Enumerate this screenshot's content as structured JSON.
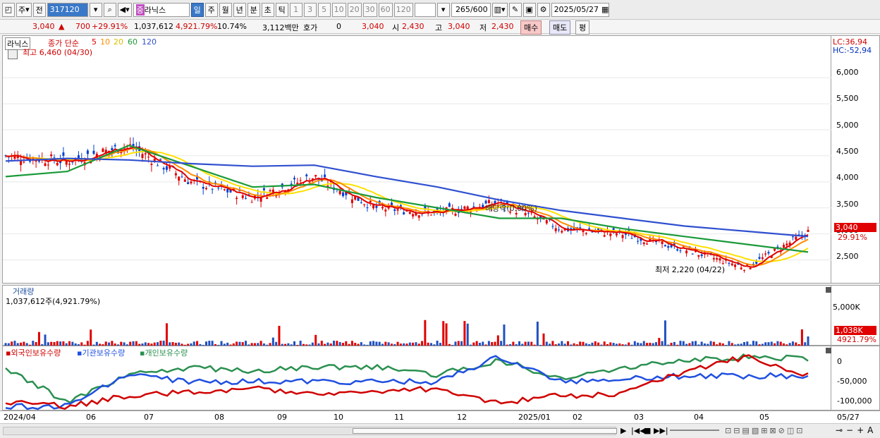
{
  "toolbar": {
    "code": "317120",
    "name": "라닉스",
    "mode1": "주",
    "mode2": "전",
    "periods": [
      "일",
      "주",
      "월",
      "년",
      "분",
      "초",
      "틱"
    ],
    "minutes": [
      "1",
      "3",
      "5",
      "10",
      "20",
      "30",
      "60",
      "120"
    ],
    "count": "265",
    "count_total": "/600",
    "date": "2025/05/27",
    "stock_tag": "중"
  },
  "info": {
    "price": "3,040",
    "change": "700",
    "change_pct": "+29.91%",
    "volume": "1,037,612",
    "vol_pct": "4,921.79%",
    "turnover": "10.74%",
    "amount": "3,112백만",
    "quote_label": "호가",
    "quote_val": "0",
    "quote_price": "3,040",
    "open_label": "시",
    "open": "2,430",
    "high_label": "고",
    "high": "3,040",
    "low_label": "저",
    "low": "2,430",
    "buy": "매수",
    "sell": "매도",
    "avg": "평"
  },
  "price_panel": {
    "stock": "라닉스",
    "legend": [
      "종가 단순",
      "5",
      "10",
      "20",
      "60",
      "120"
    ],
    "max_note": "최고 6,460 (04/30)",
    "min_note": "최저 2,220 (04/22)",
    "div_note": "배당락(0.00%)",
    "lc": "LC:36,94",
    "hc": "HC:-52,94",
    "price_tag": "3,040",
    "pct_tag": "29.91%",
    "y_ticks": [
      "6,000",
      "5,500",
      "5,000",
      "4,500",
      "4,000",
      "3,500",
      "3,000",
      "2,500"
    ]
  },
  "volume_panel": {
    "title": "거래량",
    "value": "1,037,612주(4,921.79%)",
    "y_ticks": [
      "5,000K",
      "0K"
    ],
    "tag": "1,038K",
    "pct": "4921.79%"
  },
  "holder_panel": {
    "legend": [
      "외국인보유수량",
      "기관보유수량",
      "개인보유수량"
    ],
    "y_ticks": [
      "0",
      "-50,000",
      "-100,000"
    ]
  },
  "x_labels": [
    "2024/04",
    "06",
    "07",
    "08",
    "09",
    "10",
    "11",
    "12",
    "2025/01",
    "02",
    "03",
    "04",
    "05",
    "05/27"
  ],
  "colors": {
    "red": "#d00000",
    "blue": "#2050e0",
    "green": "#2a9050",
    "ma5": "#e00000",
    "ma10": "#ff8c00",
    "ma20": "#ffe000",
    "ma60": "#1a9a3a",
    "ma120": "#3050d0"
  },
  "chart_data": {
    "type": "line",
    "title": "",
    "ylim": [
      2100,
      6600
    ],
    "x": [
      "2024/04",
      "06",
      "07",
      "08",
      "09",
      "10",
      "11",
      "12",
      "2025/01",
      "02",
      "03",
      "04",
      "05",
      "05/27"
    ],
    "series": [
      {
        "name": "종가",
        "values": [
          4500,
          4400,
          4700,
          4000,
          3700,
          4100,
          3500,
          3400,
          3600,
          3100,
          3000,
          2700,
          2350,
          3040
        ]
      },
      {
        "name": "120",
        "values": [
          4400,
          4450,
          4420,
          4350,
          4300,
          4320,
          4100,
          3900,
          3650,
          3450,
          3300,
          3150,
          3050,
          2950
        ]
      },
      {
        "name": "60",
        "values": [
          4100,
          4200,
          4700,
          4300,
          3900,
          3950,
          3700,
          3500,
          3300,
          3300,
          3100,
          2950,
          2800,
          2650
        ]
      }
    ]
  }
}
